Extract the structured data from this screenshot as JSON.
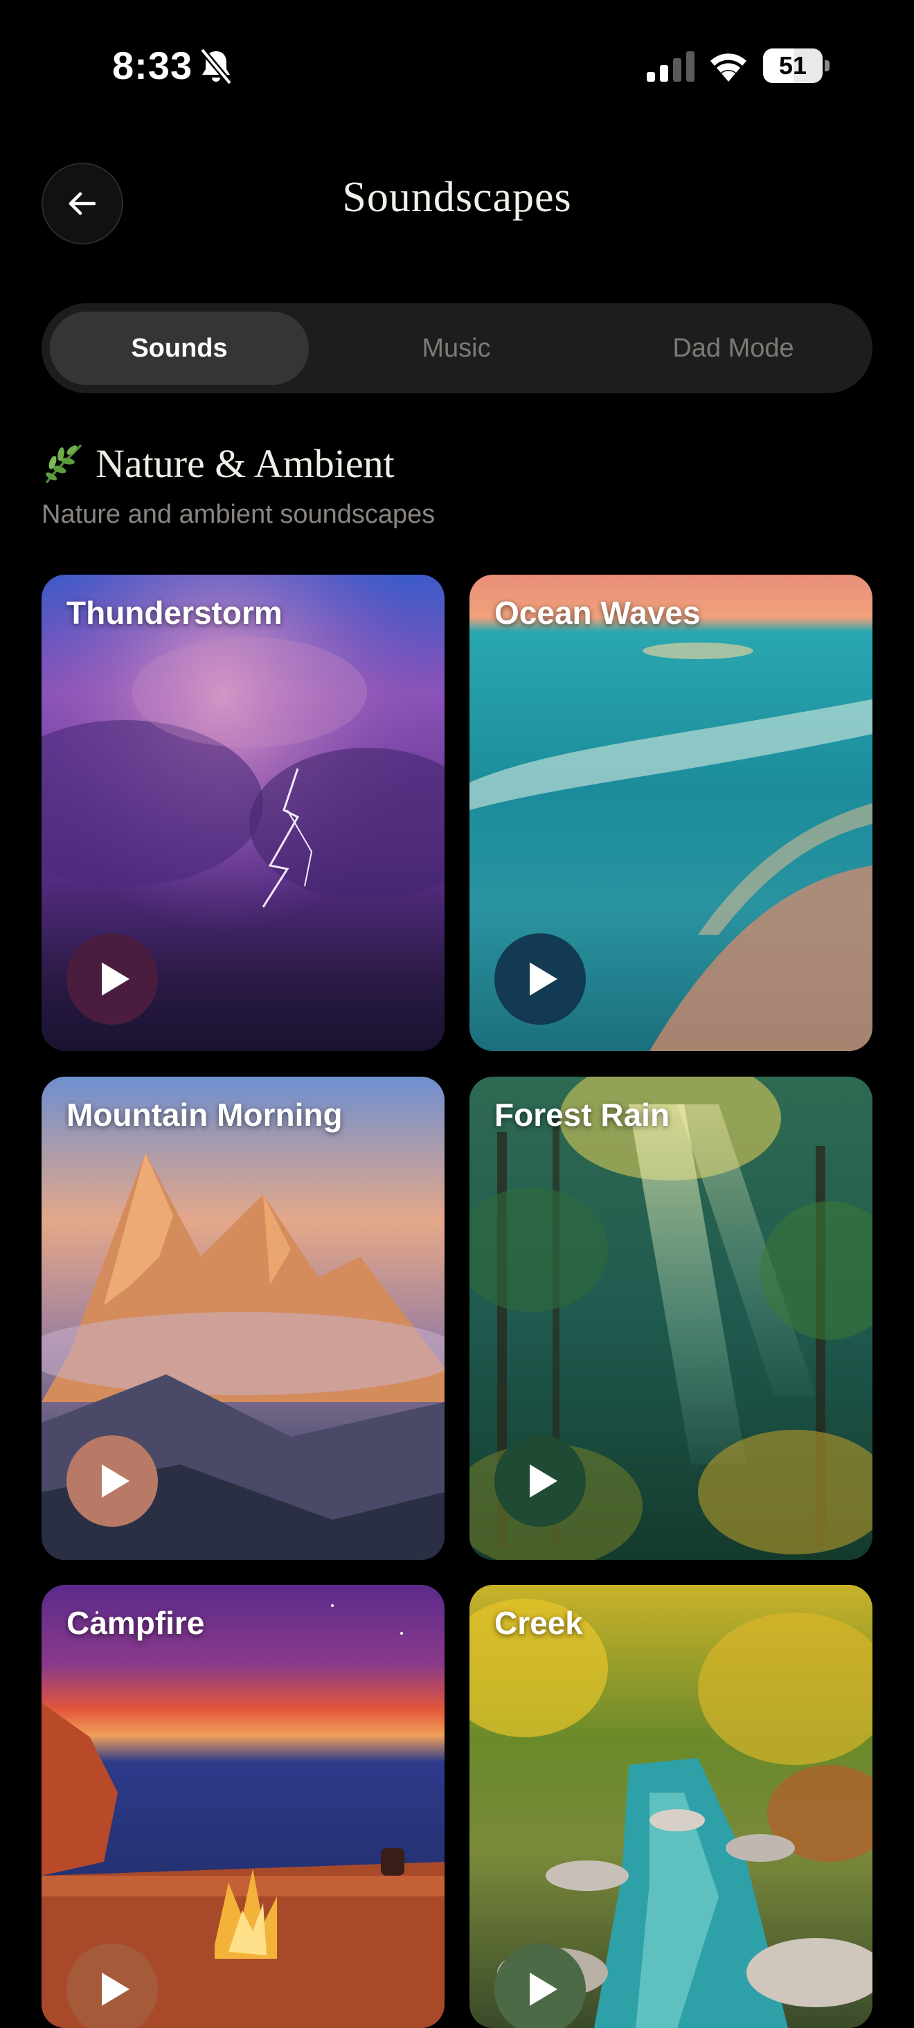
{
  "status_bar": {
    "time": "8:33",
    "battery": "51",
    "battery_level": 0.51
  },
  "header": {
    "title": "Soundscapes"
  },
  "tabs": [
    {
      "label": "Sounds",
      "active": true
    },
    {
      "label": "Music",
      "active": false
    },
    {
      "label": "Dad Mode",
      "active": false
    }
  ],
  "section": {
    "title": "Nature & Ambient",
    "subtitle": "Nature and ambient soundscapes"
  },
  "cards": [
    {
      "title": "Thunderstorm",
      "play_color": "#4a1d3f"
    },
    {
      "title": "Ocean Waves",
      "play_color": "#123a52"
    },
    {
      "title": "Mountain Morning",
      "play_color": "#b87a66"
    },
    {
      "title": "Forest Rain",
      "play_color": "#1f4a33"
    },
    {
      "title": "Campfire",
      "play_color": "#a55a3a"
    },
    {
      "title": "Creek",
      "play_color": "#4d6a46"
    }
  ],
  "icons": {
    "back": "arrow-left-icon",
    "play": "play-icon",
    "section": "leaf-icon",
    "mute": "bell-slash-icon",
    "signal": "cellular-signal-icon",
    "wifi": "wifi-icon"
  },
  "colors": {
    "background": "#000000",
    "segment_bg": "#1d1d1d",
    "segment_active": "#353535",
    "muted_text": "#8a8580"
  }
}
